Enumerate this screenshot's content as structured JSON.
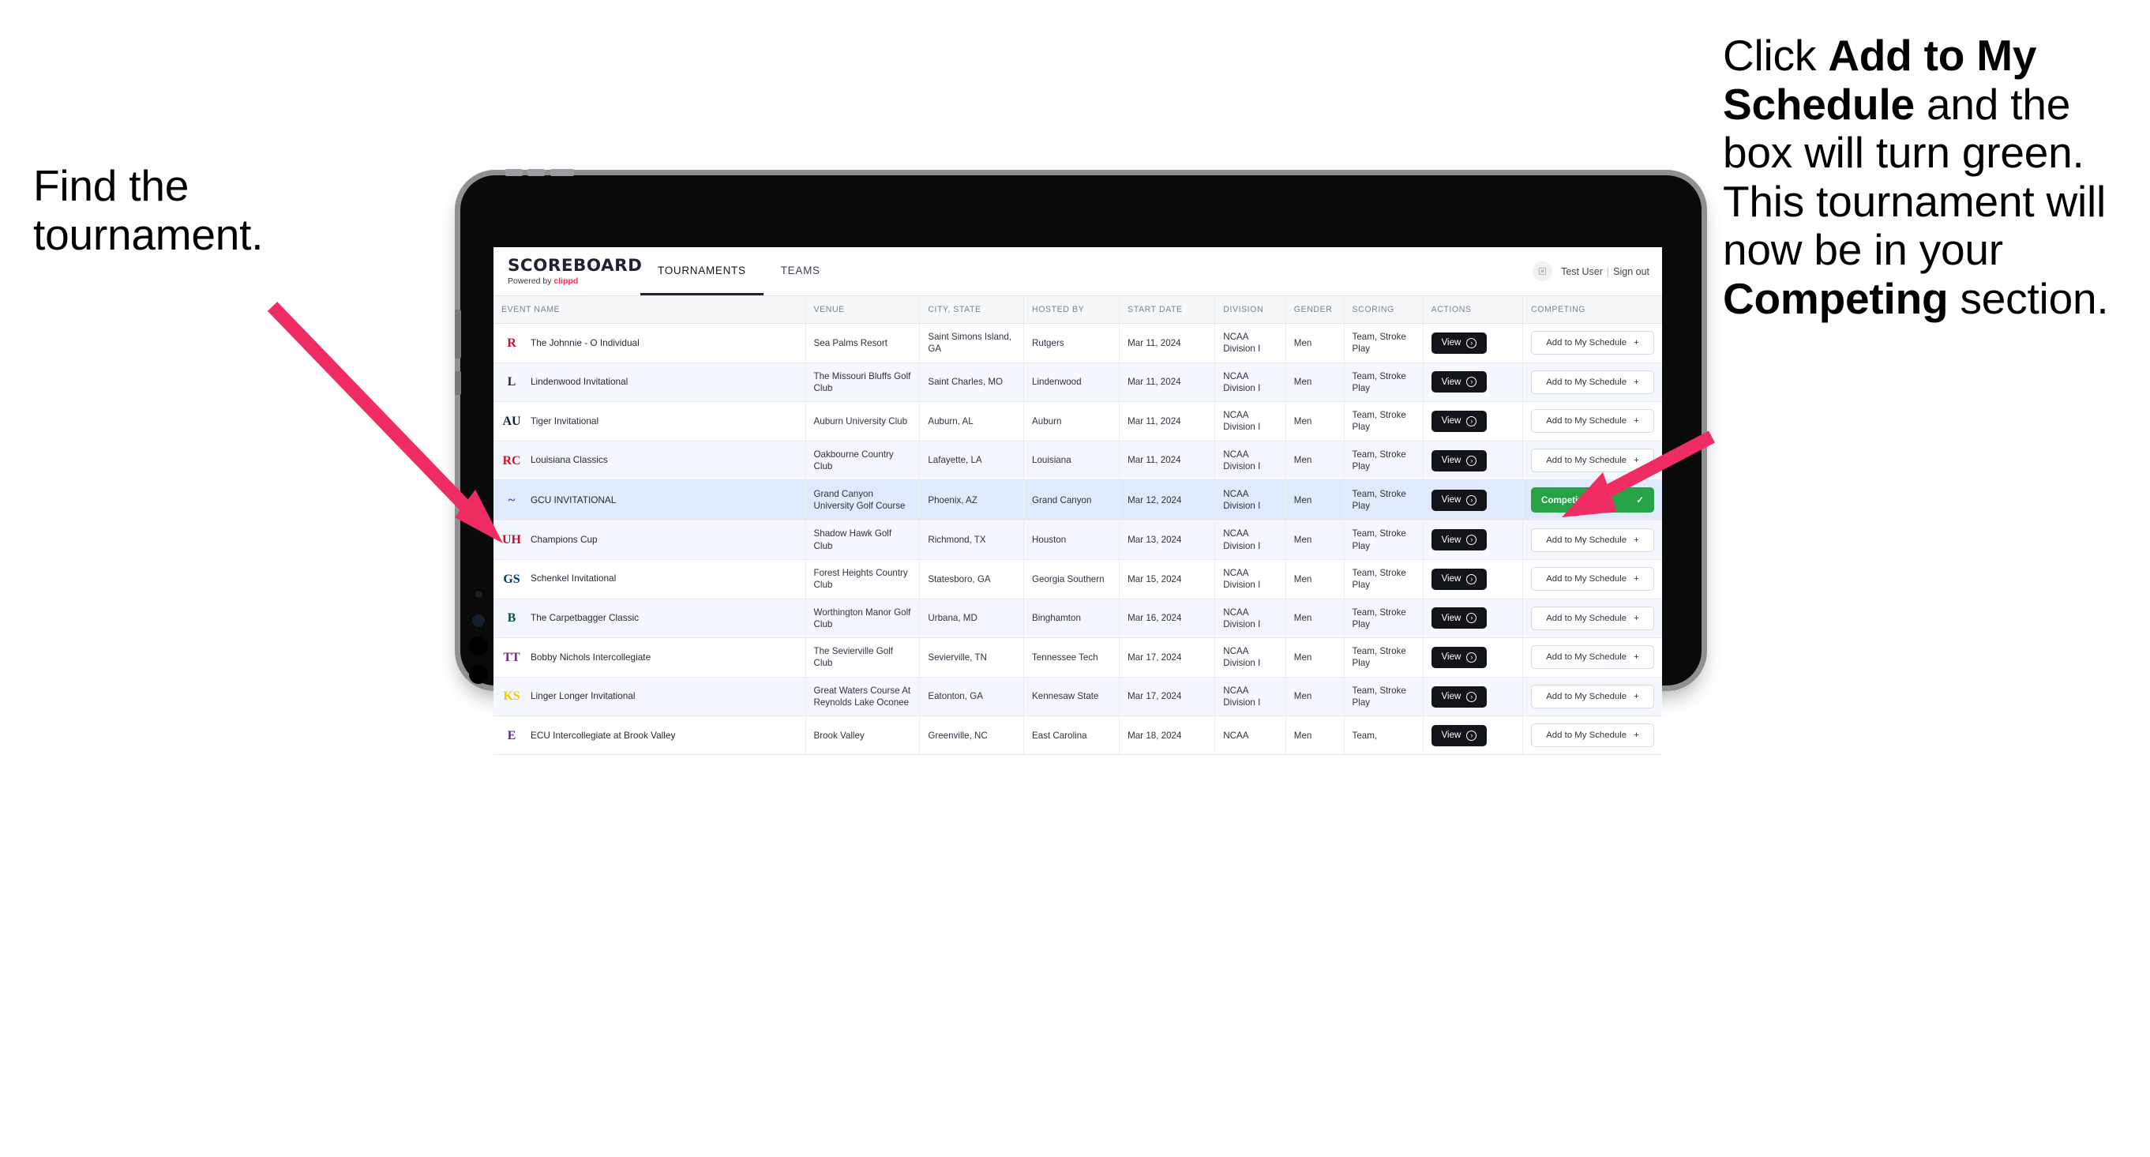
{
  "annotations": {
    "left": [
      {
        "text": "Find the ",
        "bold": false
      },
      {
        "text": "tournament.",
        "bold": false
      }
    ],
    "left_plain": "Find the tournament.",
    "right_segments": [
      {
        "text": "Click ",
        "bold": false
      },
      {
        "text": "Add to My Schedule",
        "bold": true
      },
      {
        "text": " and the box will turn green. This tournament will now be in your ",
        "bold": false
      },
      {
        "text": "Competing",
        "bold": true
      },
      {
        "text": " section.",
        "bold": false
      }
    ],
    "arrow_color": "#ef2d62"
  },
  "app": {
    "brand": {
      "title": "SCOREBOARD",
      "powered_prefix": "Powered by ",
      "powered_name": "clippd"
    },
    "tabs": [
      {
        "label": "TOURNAMENTS",
        "active": true
      },
      {
        "label": "TEAMS",
        "active": false
      }
    ],
    "user": {
      "avatar_icon": "user-avatar-icon",
      "name": "Test User",
      "separator": "|",
      "signout": "Sign out"
    }
  },
  "table": {
    "columns": [
      "EVENT NAME",
      "VENUE",
      "CITY, STATE",
      "HOSTED BY",
      "START DATE",
      "DIVISION",
      "GENDER",
      "SCORING",
      "ACTIONS",
      "COMPETING"
    ],
    "view_label": "View",
    "add_label": "Add to My Schedule",
    "add_plus": "+",
    "competing_label": "Competing",
    "competing_check": "✓",
    "rows": [
      {
        "event": "The Johnnie - O Individual",
        "logo": {
          "text": "R",
          "color": "#c8102e",
          "bg": "transparent"
        },
        "venue": "Sea Palms Resort",
        "city": "Saint Simons Island, GA",
        "hosted_by": "Rutgers",
        "start_date": "Mar 11, 2024",
        "division": "NCAA Division I",
        "gender": "Men",
        "scoring": "Team, Stroke Play",
        "competing": false
      },
      {
        "event": "Lindenwood Invitational",
        "logo": {
          "text": "L",
          "color": "#2b2b2b",
          "bg": "transparent"
        },
        "venue": "The Missouri Bluffs Golf Club",
        "city": "Saint Charles, MO",
        "hosted_by": "Lindenwood",
        "start_date": "Mar 11, 2024",
        "division": "NCAA Division I",
        "gender": "Men",
        "scoring": "Team, Stroke Play",
        "competing": false
      },
      {
        "event": "Tiger Invitational",
        "logo": {
          "text": "AU",
          "color": "#0c2340",
          "bg": "transparent"
        },
        "venue": "Auburn University Club",
        "city": "Auburn, AL",
        "hosted_by": "Auburn",
        "start_date": "Mar 11, 2024",
        "division": "NCAA Division I",
        "gender": "Men",
        "scoring": "Team, Stroke Play",
        "competing": false
      },
      {
        "event": "Louisiana Classics",
        "logo": {
          "text": "RC",
          "color": "#ce181e",
          "bg": "transparent"
        },
        "venue": "Oakbourne Country Club",
        "city": "Lafayette, LA",
        "hosted_by": "Louisiana",
        "start_date": "Mar 11, 2024",
        "division": "NCAA Division I",
        "gender": "Men",
        "scoring": "Team, Stroke Play",
        "competing": false
      },
      {
        "event": "GCU INVITATIONAL",
        "logo": {
          "text": "~",
          "color": "#522398",
          "bg": "transparent"
        },
        "venue": "Grand Canyon University Golf Course",
        "city": "Phoenix, AZ",
        "hosted_by": "Grand Canyon",
        "start_date": "Mar 12, 2024",
        "division": "NCAA Division I",
        "gender": "Men",
        "scoring": "Team, Stroke Play",
        "competing": true,
        "selected": true
      },
      {
        "event": "Champions Cup",
        "logo": {
          "text": "UH",
          "color": "#c8102e",
          "bg": "transparent"
        },
        "venue": "Shadow Hawk Golf Club",
        "city": "Richmond, TX",
        "hosted_by": "Houston",
        "start_date": "Mar 13, 2024",
        "division": "NCAA Division I",
        "gender": "Men",
        "scoring": "Team, Stroke Play",
        "competing": false
      },
      {
        "event": "Schenkel Invitational",
        "logo": {
          "text": "GS",
          "color": "#003775",
          "bg": "transparent"
        },
        "venue": "Forest Heights Country Club",
        "city": "Statesboro, GA",
        "hosted_by": "Georgia Southern",
        "start_date": "Mar 15, 2024",
        "division": "NCAA Division I",
        "gender": "Men",
        "scoring": "Team, Stroke Play",
        "competing": false
      },
      {
        "event": "The Carpetbagger Classic",
        "logo": {
          "text": "B",
          "color": "#00573f",
          "bg": "transparent"
        },
        "venue": "Worthington Manor Golf Club",
        "city": "Urbana, MD",
        "hosted_by": "Binghamton",
        "start_date": "Mar 16, 2024",
        "division": "NCAA Division I",
        "gender": "Men",
        "scoring": "Team, Stroke Play",
        "competing": false
      },
      {
        "event": "Bobby Nichols Intercollegiate",
        "logo": {
          "text": "TT",
          "color": "#6b2a8b",
          "bg": "transparent"
        },
        "venue": "The Sevierville Golf Club",
        "city": "Sevierville, TN",
        "hosted_by": "Tennessee Tech",
        "start_date": "Mar 17, 2024",
        "division": "NCAA Division I",
        "gender": "Men",
        "scoring": "Team, Stroke Play",
        "competing": false
      },
      {
        "event": "Linger Longer Invitational",
        "logo": {
          "text": "KS",
          "color": "#f7c600",
          "bg": "transparent"
        },
        "venue": "Great Waters Course At Reynolds Lake Oconee",
        "city": "Eatonton, GA",
        "hosted_by": "Kennesaw State",
        "start_date": "Mar 17, 2024",
        "division": "NCAA Division I",
        "gender": "Men",
        "scoring": "Team, Stroke Play",
        "competing": false
      },
      {
        "event": "ECU Intercollegiate at Brook Valley",
        "logo": {
          "text": "E",
          "color": "#592a8a",
          "bg": "transparent"
        },
        "venue": "Brook Valley",
        "city": "Greenville, NC",
        "hosted_by": "East Carolina",
        "start_date": "Mar 18, 2024",
        "division": "NCAA",
        "gender": "Men",
        "scoring": "Team,",
        "competing": false,
        "clipped": true
      }
    ]
  }
}
